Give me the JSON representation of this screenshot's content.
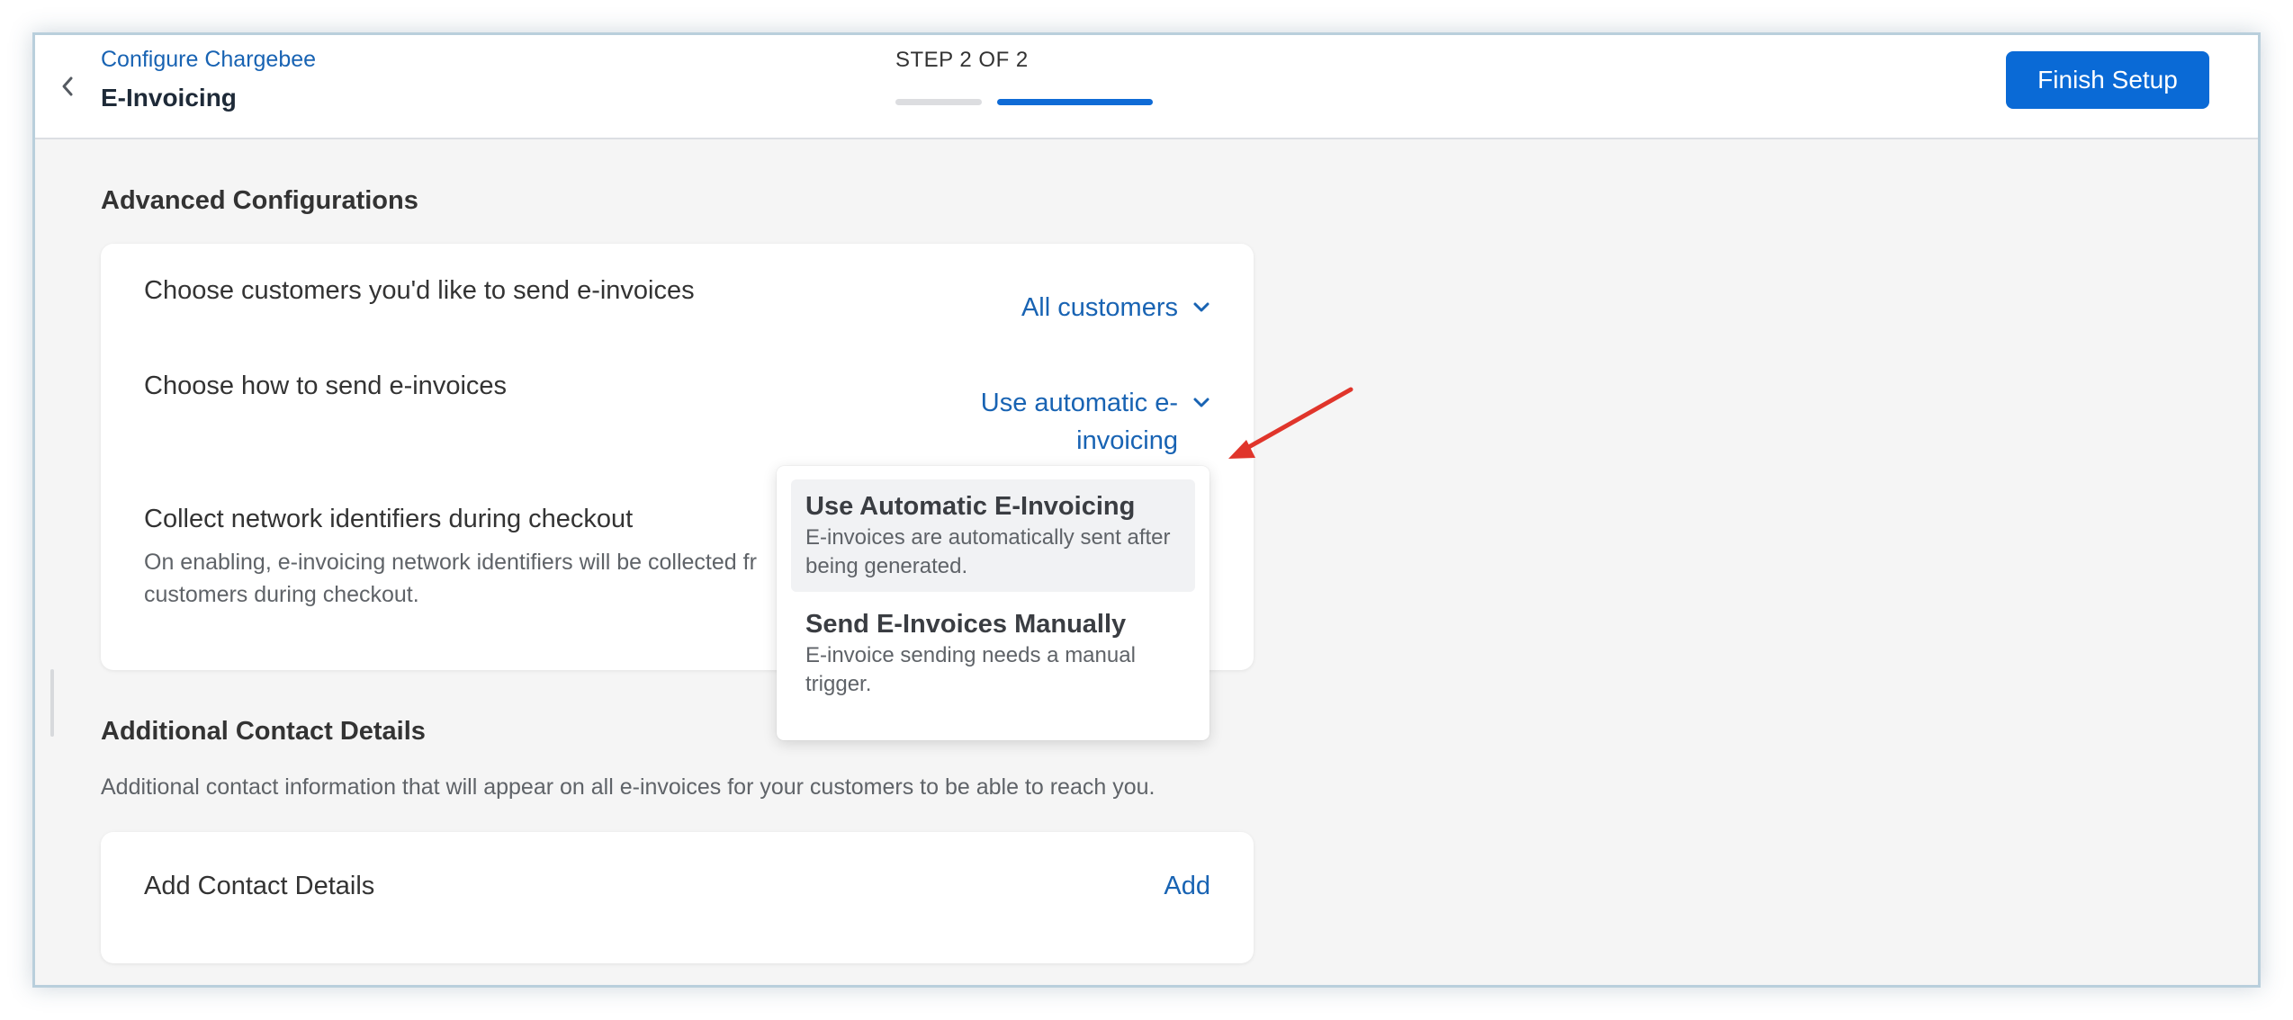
{
  "header": {
    "breadcrumb": "Configure Chargebee",
    "title": "E-Invoicing",
    "step_label": "STEP 2 OF 2",
    "finish_label": "Finish Setup"
  },
  "advanced": {
    "title": "Advanced Configurations",
    "customers": {
      "label": "Choose customers you'd like to send e-invoices",
      "value": "All customers"
    },
    "send_method": {
      "label": "Choose how to send e-invoices",
      "value_line1": "Use automatic e-",
      "value_line2": "invoicing"
    },
    "network": {
      "label": "Collect network identifiers during checkout",
      "desc_line1": "On enabling, e-invoicing network identifiers will be collected fr",
      "desc_line2": "customers during checkout."
    }
  },
  "contact": {
    "title": "Additional Contact Details",
    "help": "Additional contact information that will appear on all e-invoices for your customers to be able to reach you.",
    "row_label": "Add Contact Details",
    "add_label": "Add"
  },
  "menu": {
    "items": [
      {
        "title": "Use Automatic E-Invoicing",
        "desc": "E-invoices are automatically sent after being generated."
      },
      {
        "title": "Send E-Invoices Manually",
        "desc": "E-invoice sending needs a manual trigger."
      }
    ]
  },
  "colors": {
    "accent": "#0a6ad6",
    "link": "#1863b3",
    "annotation_arrow": "#e0352b"
  },
  "progress": {
    "current_step": 2,
    "total_steps": 2
  }
}
